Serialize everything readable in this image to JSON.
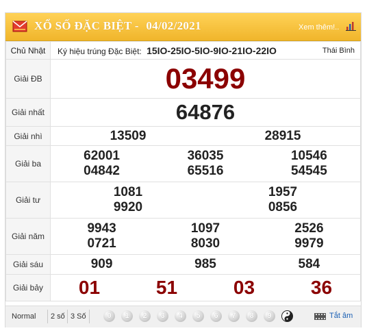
{
  "header": {
    "title": "XỔ SỐ ĐẶC BIỆT -",
    "date": "04/02/2021",
    "see_more": "Xem thêm!.."
  },
  "day_row": {
    "weekday": "Chủ Nhật",
    "symbols_label": "Ký hiệu trúng Đặc Biệt:",
    "symbols_value": "15IO-25IO-5IO-9IO-21IO-22IO",
    "province": "Thái Bình"
  },
  "prizes": {
    "db": {
      "label": "Giải ĐB",
      "numbers": [
        "03499"
      ]
    },
    "nhat": {
      "label": "Giải nhất",
      "numbers": [
        "64876"
      ]
    },
    "nhi": {
      "label": "Giải nhì",
      "numbers": [
        "13509",
        "28915"
      ]
    },
    "ba": {
      "label": "Giải ba",
      "numbers": [
        "62001",
        "36035",
        "10546",
        "04842",
        "65516",
        "54545"
      ]
    },
    "tu": {
      "label": "Giải tư",
      "numbers": [
        "1081",
        "1957",
        "9920",
        "0856"
      ]
    },
    "nam": {
      "label": "Giải năm",
      "numbers": [
        "9943",
        "1097",
        "2526",
        "0721",
        "8030",
        "9979"
      ]
    },
    "sau": {
      "label": "Giải sáu",
      "numbers": [
        "909",
        "985",
        "584"
      ]
    },
    "bay": {
      "label": "Giải bảy",
      "numbers": [
        "01",
        "51",
        "03",
        "36"
      ]
    }
  },
  "footer": {
    "modes": [
      "Normal",
      "2 số",
      "3 Số"
    ],
    "digits": [
      "0",
      "1",
      "2",
      "3",
      "4",
      "5",
      "6",
      "7",
      "8",
      "9"
    ],
    "all_off": "Tắt âm"
  },
  "colors": {
    "header_bg": "#f0b52b",
    "prize_highlight": "#8b0000",
    "link": "#1a5fb4"
  }
}
